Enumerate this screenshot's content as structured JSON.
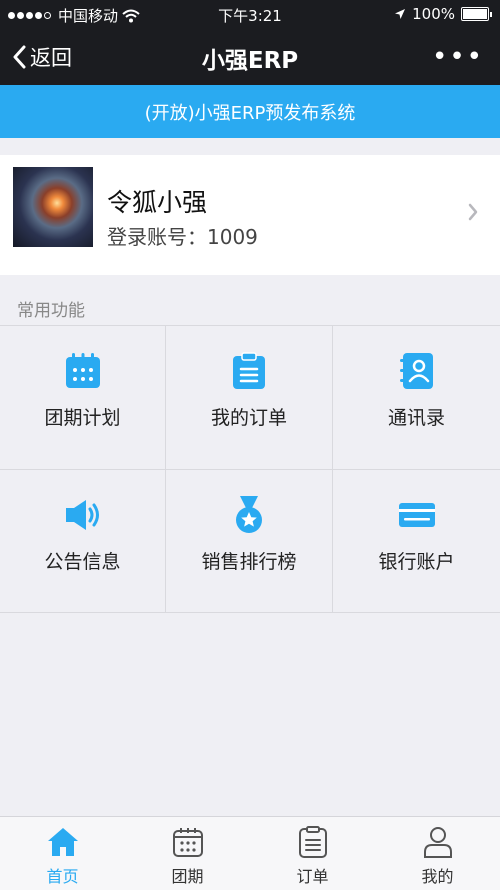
{
  "status_bar": {
    "carrier": "中国移动",
    "time": "下午3:21",
    "battery": "100%"
  },
  "nav": {
    "back_label": "返回",
    "title": "小强ERP",
    "more": "•••"
  },
  "banner": {
    "text": "(开放)小强ERP预发布系统"
  },
  "profile": {
    "name": "令狐小强",
    "account": "登录账号：1009"
  },
  "section": {
    "title": "常用功能"
  },
  "functions": [
    {
      "label": "团期计划",
      "icon": "calendar-icon"
    },
    {
      "label": "我的订单",
      "icon": "clipboard-icon"
    },
    {
      "label": "通讯录",
      "icon": "contacts-book-icon"
    },
    {
      "label": "公告信息",
      "icon": "speaker-icon"
    },
    {
      "label": "销售排行榜",
      "icon": "medal-icon"
    },
    {
      "label": "银行账户",
      "icon": "bank-card-icon"
    }
  ],
  "tabs": [
    {
      "label": "首页",
      "icon": "home-icon",
      "active": true
    },
    {
      "label": "团期",
      "icon": "calendar-icon",
      "active": false
    },
    {
      "label": "订单",
      "icon": "clipboard-icon",
      "active": false
    },
    {
      "label": "我的",
      "icon": "user-icon",
      "active": false
    }
  ],
  "colors": {
    "accent": "#2aaaf1",
    "nav_bg": "#1b1c20",
    "page_bg": "#efeff4"
  }
}
